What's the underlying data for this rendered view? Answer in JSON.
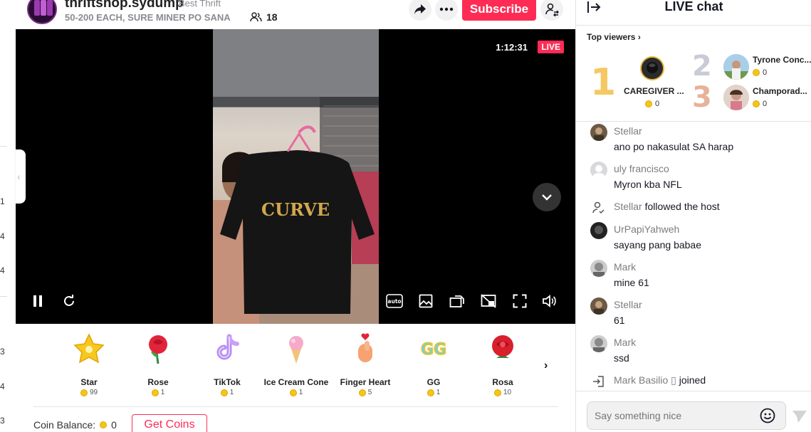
{
  "left_sliver": {
    "numbers": [
      "1",
      "4",
      "4",
      "3",
      "4",
      "3"
    ]
  },
  "header": {
    "host_name": "thriftshop.sydump",
    "host_tag": "Best Thrift",
    "description": "50-200 EACH, SURE MINER PO SANA",
    "viewer_count": "18",
    "subscribe_label": "Subscribe",
    "icons": [
      "share-icon",
      "more-icon",
      "user-switch-icon"
    ]
  },
  "video": {
    "timer": "1:12:31",
    "live_label": "LIVE",
    "shirt_print": "CURVE",
    "controls": [
      "pause-icon",
      "refresh-icon",
      "auto-quality-icon",
      "picture-icon",
      "rotate-icon",
      "screen-off-icon",
      "fullscreen-icon",
      "volume-icon"
    ]
  },
  "gifts": {
    "items": [
      {
        "name": "Star",
        "price": "99",
        "color": "#f7c81e"
      },
      {
        "name": "Rose",
        "price": "1",
        "color": "#e2243b"
      },
      {
        "name": "TikTok",
        "price": "1",
        "color": "#c9a0f5"
      },
      {
        "name": "Ice Cream Cone",
        "price": "1",
        "color": "#f7a9c9"
      },
      {
        "name": "Finger Heart",
        "price": "5",
        "color": "#f6a271"
      },
      {
        "name": "GG",
        "price": "1",
        "color": "#6ad1f2"
      },
      {
        "name": "Rosa",
        "price": "10",
        "color": "#d91f2c"
      }
    ],
    "coin_balance_label": "Coin Balance:",
    "coin_balance": "0",
    "get_coins_label": "Get Coins"
  },
  "chat": {
    "title": "LIVE chat",
    "top_viewers_label": "Top viewers",
    "top_viewers": [
      {
        "rank": "1",
        "name": "CAREGIVER ...",
        "score": "0"
      },
      {
        "rank": "2",
        "name": "Tyrone Conc...",
        "score": "0"
      },
      {
        "rank": "3",
        "name": "Champorad...",
        "score": "0"
      }
    ],
    "messages": [
      {
        "user": "Stellar",
        "text": "ano po nakasulat SA harap"
      },
      {
        "user": "uly francisco",
        "text": "Myron kba NFL"
      },
      {
        "user": "Stellar",
        "event": "followed the host"
      },
      {
        "user": "UrPapiYahweh",
        "text": "sayang pang babae"
      },
      {
        "user": "Mark",
        "text": "mine 61"
      },
      {
        "user": "Stellar",
        "text": "61"
      },
      {
        "user": "Mark",
        "text": "ssd"
      },
      {
        "user": "Mark Basilio ▯",
        "event": "joined"
      }
    ],
    "input_placeholder": "Say something nice"
  }
}
